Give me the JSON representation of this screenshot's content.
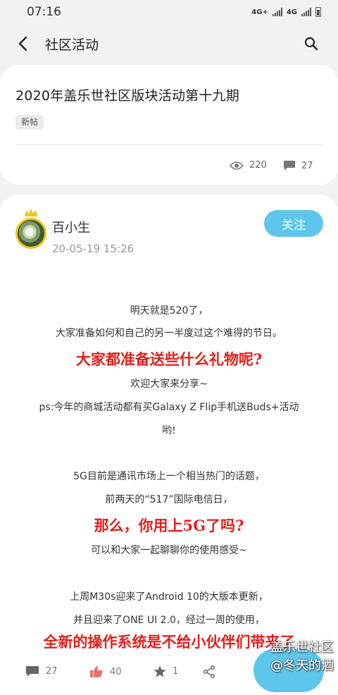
{
  "status_bar": {
    "time": "07:16",
    "net1": "4G+",
    "net2": "4G"
  },
  "app_bar": {
    "title": "社区活动"
  },
  "thread": {
    "title": "2020年盖乐世社区版块活动第十九期",
    "tag": "新帖",
    "views": "220",
    "comments": "27"
  },
  "post": {
    "author": "百小生",
    "time": "20-05-19 15:26",
    "follow_label": "关注",
    "lines": [
      "明天就是520了，",
      "大家准备如何和自己的另一半度过这个难得的节日。",
      "大家都准备送些什么礼物呢?",
      "欢迎大家来分享~",
      "ps:今年的商城活动都有买Galaxy Z Flip手机送Buds+活动",
      "哟!",
      "5G目前是通讯市场上一个相当热门的话题，",
      "前两天的“517”国际电信日，",
      "那么，你用上5G了吗?",
      "可以和大家一起聊聊你的使用感受~",
      "上周M30s迎来了Android 10的大版本更新，",
      "并且迎来了ONE UI 2.0，经过一周的使用，",
      "全新的操作系统是不给小伙伴们带来了"
    ]
  },
  "actions": {
    "comments": "27",
    "likes": "40",
    "favorites": "1"
  },
  "watermark": {
    "line1": "盖乐世社区",
    "line2": "@冬天的酒"
  },
  "colors": {
    "accent": "#5ec6ea",
    "highlight": "#e0201c"
  }
}
